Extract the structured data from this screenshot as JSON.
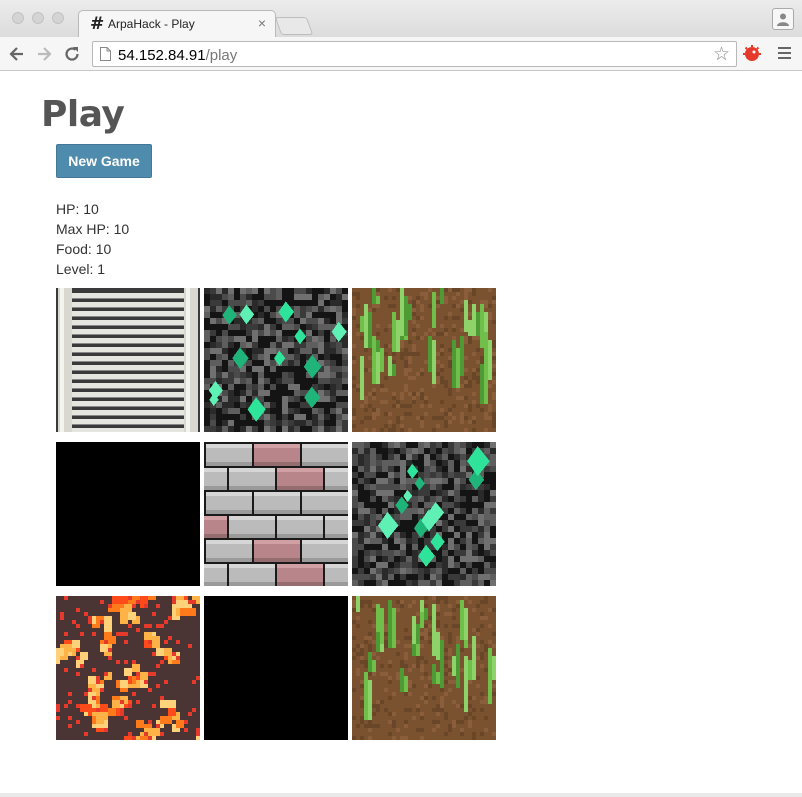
{
  "browser": {
    "tab_title": "ArpaHack - Play",
    "url_host": "54.152.84.91",
    "url_path": "/play"
  },
  "page": {
    "title": "Play",
    "new_game_label": "New Game"
  },
  "stats": [
    {
      "label": "HP",
      "value": "10",
      "text": "HP: 10"
    },
    {
      "label": "Max HP",
      "value": "10",
      "text": "Max HP: 10"
    },
    {
      "label": "Food",
      "value": "10",
      "text": "Food: 10"
    },
    {
      "label": "Level",
      "value": "1",
      "text": "Level: 1"
    }
  ],
  "map": {
    "rows": 3,
    "cols": 3,
    "tiles": [
      [
        "ladder",
        "emerald-ore",
        "grass"
      ],
      [
        "void",
        "brick-wall",
        "emerald-ore"
      ],
      [
        "lava",
        "void",
        "grass"
      ]
    ]
  },
  "colors": {
    "button": "#4f8bad",
    "heading": "#555555",
    "emerald": "#2ee49a",
    "lava": "#ff7a1a",
    "grass": "#6fbf4a",
    "dirt": "#7a5230",
    "brick": "#bbbbbb",
    "brick_red": "#b8868a"
  }
}
